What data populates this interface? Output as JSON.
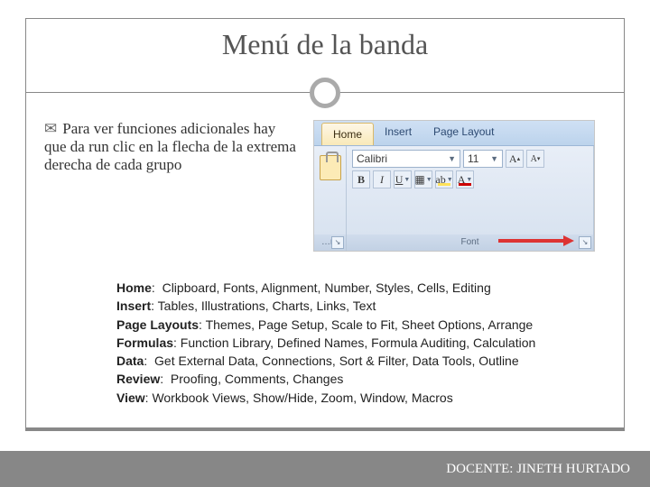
{
  "title": "Menú de la banda",
  "paragraph": "Para ver funciones adicionales hay que da run clic en la flecha de la extrema derecha de cada grupo",
  "ribbon": {
    "tabs": [
      "Home",
      "Insert",
      "Page Layout"
    ],
    "font_name": "Calibri",
    "font_size": "11",
    "group_clip_label": "…rd",
    "group_font_label": "Font",
    "btn_bold": "B",
    "btn_italic": "I",
    "btn_underline": "U",
    "grow": "A",
    "shrink": "A",
    "fillA": "ab",
    "colorA": "A"
  },
  "entries": [
    {
      "label": "Home",
      "text": "Clipboard, Fonts, Alignment, Number, Styles, Cells, Editing"
    },
    {
      "label": "Insert",
      "text": "Tables, Illustrations, Charts, Links, Text"
    },
    {
      "label": "Page Layouts",
      "text": "Themes, Page Setup, Scale to Fit, Sheet Options, Arrange"
    },
    {
      "label": "Formulas",
      "text": "Function Library, Defined Names, Formula Auditing, Calculation"
    },
    {
      "label": "Data",
      "text": "Get External Data, Connections, Sort & Filter, Data Tools, Outline"
    },
    {
      "label": "Review",
      "text": "Proofing, Comments, Changes"
    },
    {
      "label": "View",
      "text": "Workbook Views, Show/Hide, Zoom, Window, Macros"
    }
  ],
  "footer": "DOCENTE: JINETH HURTADO"
}
